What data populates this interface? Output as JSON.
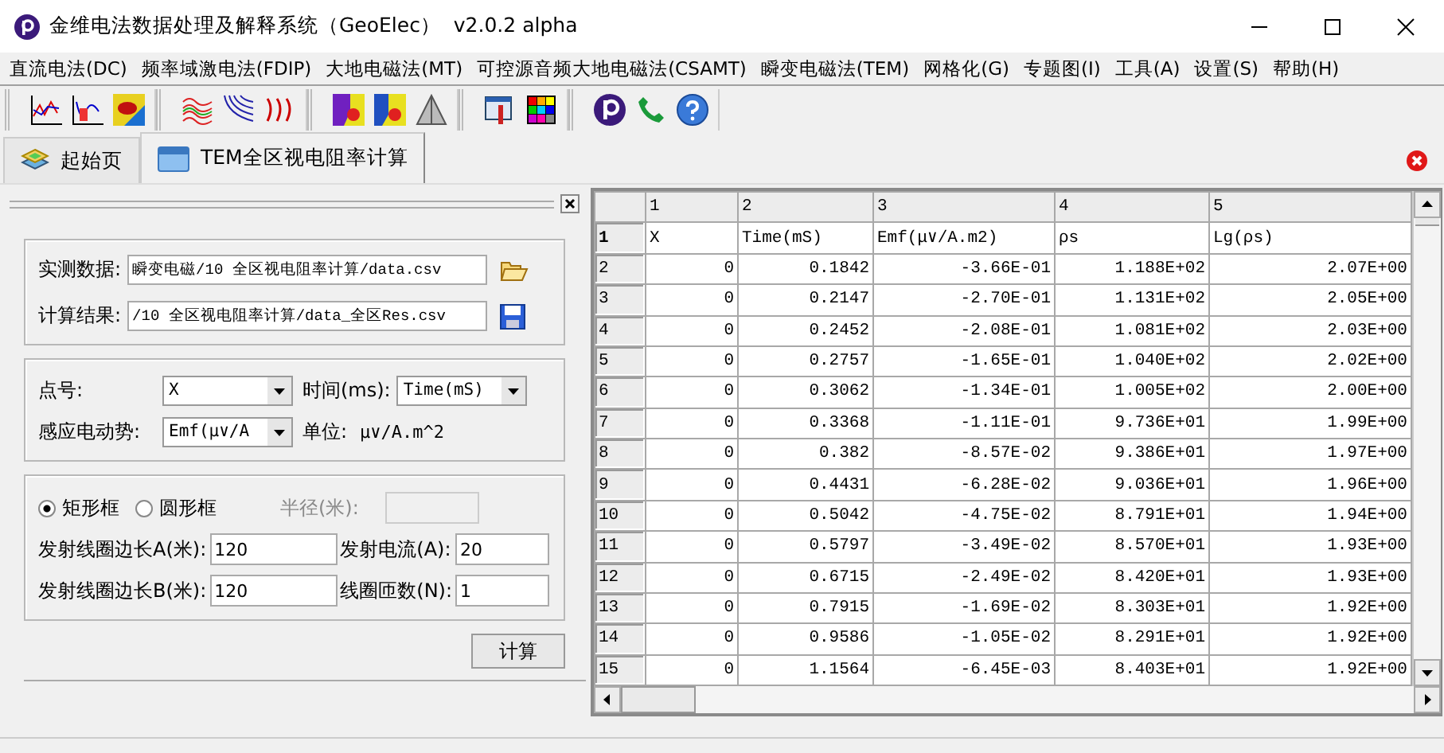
{
  "window": {
    "title": "金维电法数据处理及解释系统（GeoElec）  v2.0.2 alpha"
  },
  "menu": [
    "直流电法(DC)",
    "频率域激电法(FDIP)",
    "大地电磁法(MT)",
    "可控源音频大地电磁法(CSAMT)",
    "瞬变电磁法(TEM)",
    "网格化(G)",
    "专题图(I)",
    "工具(A)",
    "设置(S)",
    "帮助(H)"
  ],
  "tabs": [
    {
      "label": "起始页",
      "selected": false,
      "kind": "home"
    },
    {
      "label": "TEM全区视电阻率计算",
      "selected": true,
      "kind": "window"
    }
  ],
  "files": [
    {
      "label": "实测数据:",
      "value": "瞬变电磁/10 全区视电阻率计算/data.csv",
      "kind": "open"
    },
    {
      "label": "计算结果:",
      "value": "/10 全区视电阻率计算/data_全区Res.csv",
      "kind": "save"
    }
  ],
  "columns": [
    {
      "label": "点号:",
      "value": "X"
    },
    {
      "label": "时间(ms):",
      "value": "Time(mS)"
    },
    {
      "label": "感应电动势:",
      "value": "Emf(μ∨/A"
    }
  ],
  "unit": {
    "label": "单位:",
    "value": "μ∨/A.m^2"
  },
  "loop": {
    "shapes": [
      {
        "label": "矩形框",
        "selected": true
      },
      {
        "label": "圆形框",
        "selected": false
      }
    ],
    "radius": {
      "label": "半径(米):",
      "disabled": true
    },
    "fields": [
      {
        "label": "发射线圈边长A(米):",
        "value": "120"
      },
      {
        "label": "发射电流(A):",
        "value": "20"
      },
      {
        "label": "发射线圈边长B(米):",
        "value": "120"
      },
      {
        "label": "线圈匝数(N):",
        "value": "1"
      }
    ]
  },
  "calculate_button": "计算",
  "grid": {
    "column_numbers": [
      "1",
      "2",
      "3",
      "4",
      "5"
    ],
    "rows": [
      {
        "number": "1",
        "kind": "header",
        "cells": [
          "X",
          "Time(mS)",
          "Emf(μ∨/A.m2)",
          "ρs",
          "Lg(ρs)"
        ]
      },
      {
        "number": "2",
        "kind": "data",
        "cells": [
          "0",
          "0.1842",
          "-3.66E-01",
          "1.188E+02",
          "2.07E+00"
        ]
      },
      {
        "number": "3",
        "kind": "data",
        "cells": [
          "0",
          "0.2147",
          "-2.70E-01",
          "1.131E+02",
          "2.05E+00"
        ]
      },
      {
        "number": "4",
        "kind": "data",
        "cells": [
          "0",
          "0.2452",
          "-2.08E-01",
          "1.081E+02",
          "2.03E+00"
        ]
      },
      {
        "number": "5",
        "kind": "data",
        "cells": [
          "0",
          "0.2757",
          "-1.65E-01",
          "1.040E+02",
          "2.02E+00"
        ]
      },
      {
        "number": "6",
        "kind": "data",
        "cells": [
          "0",
          "0.3062",
          "-1.34E-01",
          "1.005E+02",
          "2.00E+00"
        ]
      },
      {
        "number": "7",
        "kind": "data",
        "cells": [
          "0",
          "0.3368",
          "-1.11E-01",
          "9.736E+01",
          "1.99E+00"
        ]
      },
      {
        "number": "8",
        "kind": "data",
        "cells": [
          "0",
          "0.382",
          "-8.57E-02",
          "9.386E+01",
          "1.97E+00"
        ]
      },
      {
        "number": "9",
        "kind": "data",
        "cells": [
          "0",
          "0.4431",
          "-6.28E-02",
          "9.036E+01",
          "1.96E+00"
        ]
      },
      {
        "number": "10",
        "kind": "data",
        "cells": [
          "0",
          "0.5042",
          "-4.75E-02",
          "8.791E+01",
          "1.94E+00"
        ]
      },
      {
        "number": "11",
        "kind": "data",
        "cells": [
          "0",
          "0.5797",
          "-3.49E-02",
          "8.570E+01",
          "1.93E+00"
        ]
      },
      {
        "number": "12",
        "kind": "data",
        "cells": [
          "0",
          "0.6715",
          "-2.49E-02",
          "8.420E+01",
          "1.93E+00"
        ]
      },
      {
        "number": "13",
        "kind": "data",
        "cells": [
          "0",
          "0.7915",
          "-1.69E-02",
          "8.303E+01",
          "1.92E+00"
        ]
      },
      {
        "number": "14",
        "kind": "data",
        "cells": [
          "0",
          "0.9586",
          "-1.05E-02",
          "8.291E+01",
          "1.92E+00"
        ]
      },
      {
        "number": "15",
        "kind": "data",
        "cells": [
          "0",
          "1.1564",
          "-6.45E-03",
          "8.403E+01",
          "1.92E+00"
        ]
      }
    ]
  }
}
